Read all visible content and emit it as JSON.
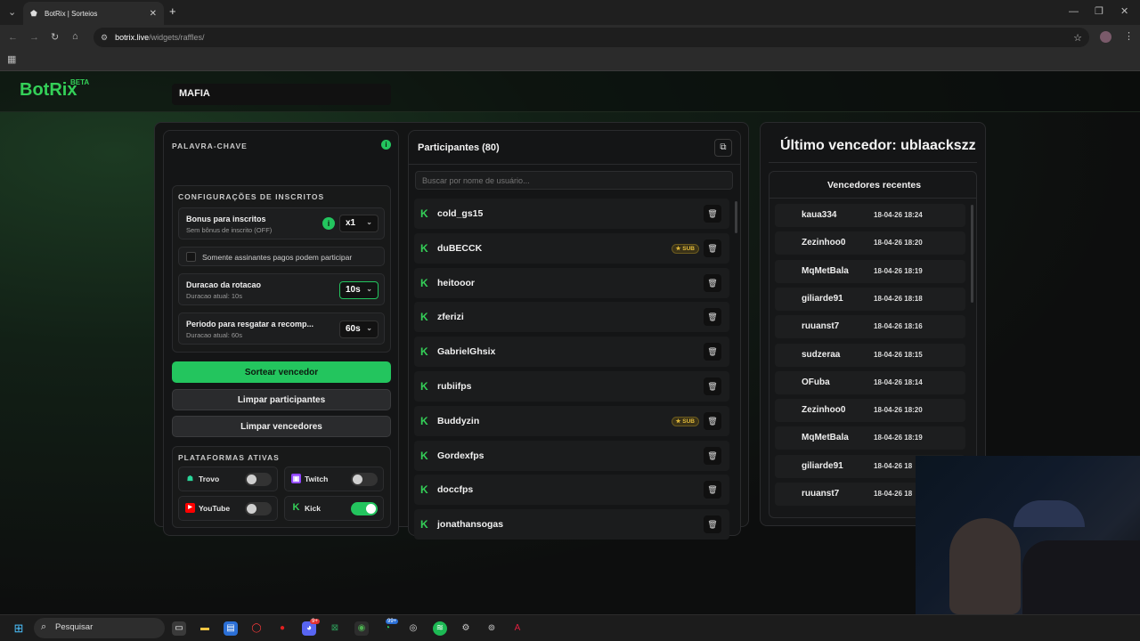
{
  "browser": {
    "tab_title": "BotRix | Sorteios",
    "url_host": "botrix.live",
    "url_path": "/widgets/raffles/"
  },
  "header": {
    "logo": "BotRix",
    "beta": "BETA"
  },
  "left_panel": {
    "keyword_label": "PALAVRA-CHAVE",
    "keyword_value": "MAFIA",
    "sub_config_title": "CONFIGURAÇÕES DE INSCRITOS",
    "bonus_title": "Bonus para inscritos",
    "bonus_sub": "Sem bônus de inscrito (OFF)",
    "bonus_value": "x1",
    "paid_only_label": "Somente assinantes pagos podem participar",
    "rotation_title": "Duracao da rotacao",
    "rotation_sub": "Duracao atual: 10s",
    "rotation_value": "10s",
    "claim_title": "Periodo para resgatar a recomp...",
    "claim_sub": "Duracao atual: 60s",
    "claim_value": "60s",
    "draw_button": "Sortear vencedor",
    "clear_participants_button": "Limpar participantes",
    "clear_winners_button": "Limpar vencedores",
    "platforms_title": "PLATAFORMAS ATIVAS",
    "platforms": [
      {
        "name": "Trovo",
        "on": false
      },
      {
        "name": "Twitch",
        "on": false
      },
      {
        "name": "YouTube",
        "on": false
      },
      {
        "name": "Kick",
        "on": true
      }
    ]
  },
  "participants": {
    "title": "Participantes (80)",
    "search_placeholder": "Buscar por nome de usuário...",
    "sub_badge": "SUB",
    "list": [
      {
        "name": "cold_gs15",
        "sub": false
      },
      {
        "name": "duBECCK",
        "sub": true
      },
      {
        "name": "heitooor",
        "sub": false
      },
      {
        "name": "zferizi",
        "sub": false
      },
      {
        "name": "GabrielGhsix",
        "sub": false
      },
      {
        "name": "rubiifps",
        "sub": false
      },
      {
        "name": "Buddyzin",
        "sub": true
      },
      {
        "name": "Gordexfps",
        "sub": false
      },
      {
        "name": "doccfps",
        "sub": false
      },
      {
        "name": "jonathansogas",
        "sub": false
      }
    ]
  },
  "winners": {
    "last_winner": "Último vencedor: ublaackszz",
    "recent_title": "Vencedores recentes",
    "list": [
      {
        "name": "kaua334",
        "date": "18-04-26 18:24"
      },
      {
        "name": "Zezinhoo0",
        "date": "18-04-26 18:20"
      },
      {
        "name": "MqMetBala",
        "date": "18-04-26 18:19"
      },
      {
        "name": "giliarde91",
        "date": "18-04-26 18:18"
      },
      {
        "name": "ruuanst7",
        "date": "18-04-26 18:16"
      },
      {
        "name": "sudzeraa",
        "date": "18-04-26 18:15"
      },
      {
        "name": "OFuba",
        "date": "18-04-26 18:14"
      },
      {
        "name": "Zezinhoo0",
        "date": "18-04-26 18:20"
      },
      {
        "name": "MqMetBala",
        "date": "18-04-26 18:19"
      },
      {
        "name": "giliarde91",
        "date": "18-04-26 18"
      },
      {
        "name": "ruuanst7",
        "date": "18-04-26 18"
      }
    ]
  },
  "taskbar": {
    "search_label": "Pesquisar",
    "badge_discord": "9+",
    "badge_whatsapp": "99+"
  }
}
